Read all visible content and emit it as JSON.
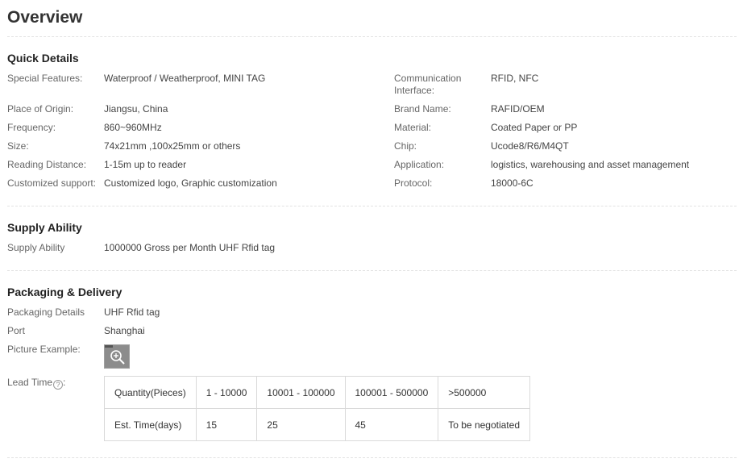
{
  "overview": {
    "title": "Overview"
  },
  "quick_details": {
    "title": "Quick Details",
    "left": [
      {
        "label": "Special Features:",
        "value": "Waterproof / Weatherproof, MINI TAG"
      },
      {
        "label": "Place of Origin:",
        "value": "Jiangsu, China"
      },
      {
        "label": "Frequency:",
        "value": "860~960MHz"
      },
      {
        "label": "Size:",
        "value": "74x21mm ,100x25mm or others"
      },
      {
        "label": "Reading Distance:",
        "value": "1-15m up to reader"
      },
      {
        "label": "Customized support:",
        "value": "Customized logo, Graphic customization"
      }
    ],
    "right": [
      {
        "label": "Communication Interface:",
        "value": "RFID, NFC"
      },
      {
        "label": "Brand Name:",
        "value": "RAFID/OEM"
      },
      {
        "label": "Material:",
        "value": "Coated Paper or PP"
      },
      {
        "label": "Chip:",
        "value": "Ucode8/R6/M4QT"
      },
      {
        "label": "Application:",
        "value": "logistics, warehousing and asset management"
      },
      {
        "label": "Protocol:",
        "value": "18000-6C"
      }
    ]
  },
  "supply": {
    "title": "Supply Ability",
    "label": "Supply Ability",
    "value": "1000000 Gross per Month UHF Rfid tag"
  },
  "packaging": {
    "title": "Packaging & Delivery",
    "details_label": "Packaging Details",
    "details_value": "UHF Rfid tag",
    "port_label": "Port",
    "port_value": "Shanghai",
    "picture_label": "Picture Example:",
    "lead_time_label": "Lead Time",
    "help_glyph": "?",
    "lead_colon": ":",
    "lead_table": {
      "header": [
        "Quantity(Pieces)",
        "1 - 10000",
        "10001 - 100000",
        "100001 - 500000",
        ">500000"
      ],
      "row": [
        "Est. Time(days)",
        "15",
        "25",
        "45",
        "To be negotiated"
      ]
    }
  },
  "icons": {
    "thumbnail_zoom": "zoom-in-icon",
    "lead_help": "help-circle-icon"
  }
}
